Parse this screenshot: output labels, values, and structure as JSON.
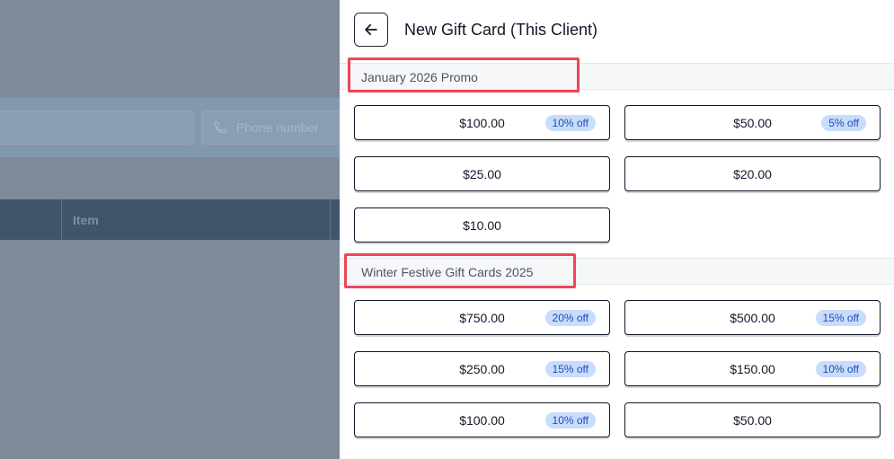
{
  "background": {
    "phone_placeholder": "Phone number",
    "table_column_item": "Item"
  },
  "drawer": {
    "title": "New Gift Card (This Client)",
    "back_icon": "arrow-left-icon"
  },
  "sections": [
    {
      "label": "January 2026 Promo",
      "cards": [
        {
          "amount": "$100.00",
          "discount": "10% off"
        },
        {
          "amount": "$50.00",
          "discount": "5% off"
        },
        {
          "amount": "$25.00",
          "discount": ""
        },
        {
          "amount": "$20.00",
          "discount": ""
        },
        {
          "amount": "$10.00",
          "discount": ""
        }
      ]
    },
    {
      "label": "Winter Festive Gift Cards 2025",
      "cards": [
        {
          "amount": "$750.00",
          "discount": "20% off"
        },
        {
          "amount": "$500.00",
          "discount": "15% off"
        },
        {
          "amount": "$250.00",
          "discount": "15% off"
        },
        {
          "amount": "$150.00",
          "discount": "10% off"
        },
        {
          "amount": "$100.00",
          "discount": "10% off"
        },
        {
          "amount": "$50.00",
          "discount": ""
        }
      ]
    }
  ],
  "colors": {
    "highlight": "#ef4459",
    "badge_bg": "#c8dcfb",
    "badge_text": "#1e4fb8"
  }
}
